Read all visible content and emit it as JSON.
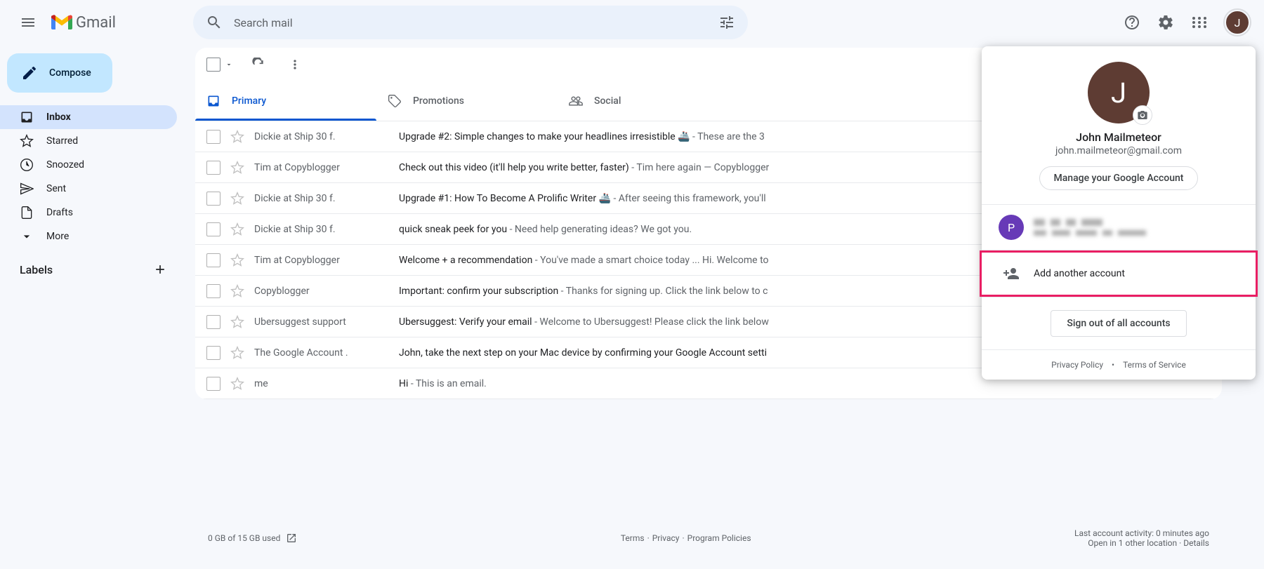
{
  "app": {
    "name": "Gmail",
    "search_placeholder": "Search mail"
  },
  "header": {
    "avatar_initial": "J"
  },
  "compose_label": "Compose",
  "sidebar": {
    "items": [
      {
        "label": "Inbox"
      },
      {
        "label": "Starred"
      },
      {
        "label": "Snoozed"
      },
      {
        "label": "Sent"
      },
      {
        "label": "Drafts"
      },
      {
        "label": "More"
      }
    ],
    "labels_heading": "Labels"
  },
  "tabs": [
    {
      "label": "Primary"
    },
    {
      "label": "Promotions"
    },
    {
      "label": "Social"
    }
  ],
  "emails": [
    {
      "sender": "Dickie at Ship 30 f.",
      "subject": "Upgrade #2: Simple changes to make your headlines irresistible 🚢",
      "snippet": " - These are the 3"
    },
    {
      "sender": "Tim at Copyblogger",
      "subject": "Check out this video (it'll help you write better, faster)",
      "snippet": " - Tim here again — Copyblogger"
    },
    {
      "sender": "Dickie at Ship 30 f.",
      "subject": "Upgrade #1: How To Become A Prolific Writer 🚢",
      "snippet": " - After seeing this framework, you'll"
    },
    {
      "sender": "Dickie at Ship 30 f.",
      "subject": "quick sneak peek for you",
      "snippet": " - Need help generating ideas? We got you."
    },
    {
      "sender": "Tim at Copyblogger",
      "subject": "Welcome + a recommendation",
      "snippet": " - You've made a smart choice today ... Hi. Welcome to"
    },
    {
      "sender": "Copyblogger",
      "subject": "Important: confirm your subscription",
      "snippet": " - Thanks for signing up. Click the link below to c"
    },
    {
      "sender": "Ubersuggest support",
      "subject": "Ubersuggest: Verify your email",
      "snippet": " - Welcome to Ubersuggest! Please click the link below"
    },
    {
      "sender": "The Google Account .",
      "subject": "John, take the next step on your Mac device by confirming your Google Account setti",
      "snippet": ""
    },
    {
      "sender": "me",
      "subject": "Hi",
      "snippet": " - This is an email."
    }
  ],
  "footer": {
    "storage": "0 GB of 15 GB used",
    "terms": "Terms",
    "privacy": "Privacy",
    "policies": "Program Policies",
    "activity": "Last account activity: 0 minutes ago",
    "open_in": "Open in 1 other location",
    "details": "Details"
  },
  "account": {
    "initial": "J",
    "name": "John Mailmeteor",
    "email": "john.mailmeteor@gmail.com",
    "manage": "Manage your Google Account",
    "other_initial": "P",
    "add_another": "Add another account",
    "signout": "Sign out of all accounts",
    "privacy_policy": "Privacy Policy",
    "dot": "•",
    "tos": "Terms of Service"
  }
}
